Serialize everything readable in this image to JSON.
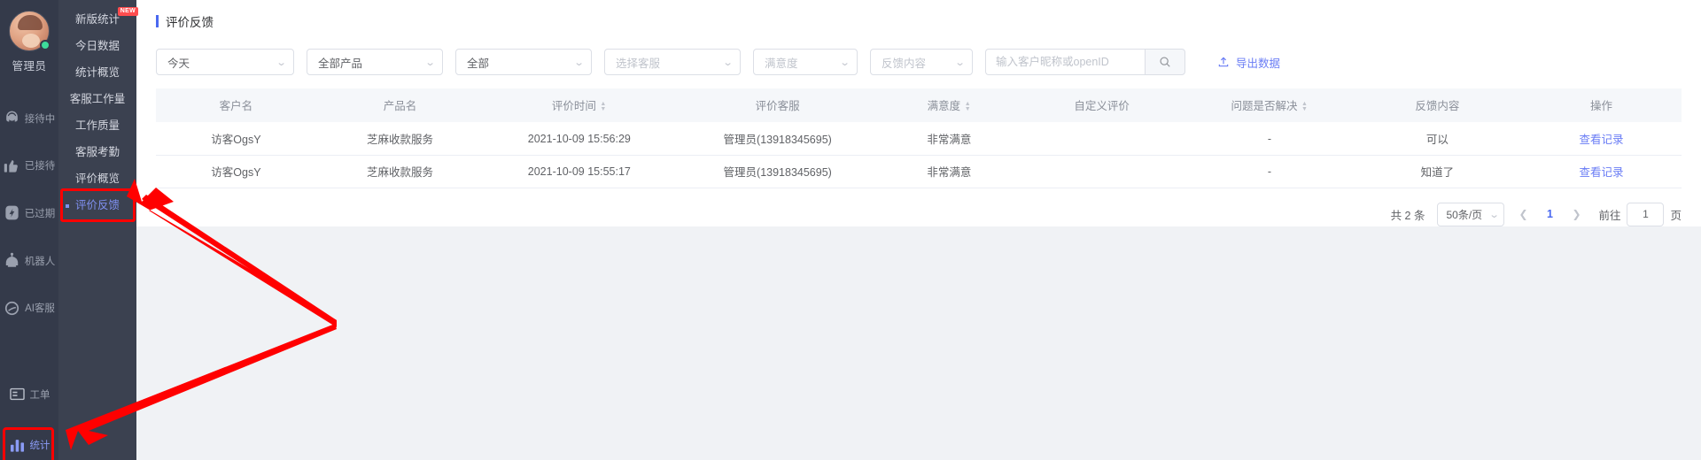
{
  "rail": {
    "user_name": "管理员",
    "items": [
      {
        "label": "接待中",
        "icon": "headset-icon"
      },
      {
        "label": "已接待",
        "icon": "thumbs-up-icon"
      },
      {
        "label": "已过期",
        "icon": "lightning-badge-icon"
      },
      {
        "label": "机器人",
        "icon": "robot-icon"
      },
      {
        "label": "AI客服",
        "icon": "ai-ring-icon"
      },
      {
        "label": "工单",
        "icon": "ticket-icon"
      },
      {
        "label": "统计",
        "icon": "bar-chart-icon"
      }
    ]
  },
  "submenu": {
    "header": "新版统计",
    "badge": "NEW",
    "items": [
      {
        "label": "今日数据"
      },
      {
        "label": "统计概览"
      },
      {
        "label": "客服工作量"
      },
      {
        "label": "工作质量"
      },
      {
        "label": "客服考勤"
      },
      {
        "label": "评价概览"
      },
      {
        "label": "评价反馈"
      }
    ],
    "selected": "评价反馈"
  },
  "page": {
    "title": "评价反馈",
    "accent": "#4a69f0"
  },
  "filters": {
    "date_range": "今天",
    "product": "全部产品",
    "scope": "全部",
    "agent_placeholder": "选择客服",
    "satisfaction_placeholder": "满意度",
    "feedback_placeholder": "反馈内容",
    "search_placeholder": "输入客户昵称或openID",
    "search_value": "",
    "search_icon": "search-icon",
    "export_label": "导出数据",
    "export_icon": "upload-icon"
  },
  "table": {
    "columns": [
      {
        "label": "客户名",
        "sortable": false
      },
      {
        "label": "产品名",
        "sortable": false
      },
      {
        "label": "评价时间",
        "sortable": true
      },
      {
        "label": "评价客服",
        "sortable": false
      },
      {
        "label": "满意度",
        "sortable": true
      },
      {
        "label": "自定义评价",
        "sortable": false
      },
      {
        "label": "问题是否解决",
        "sortable": true
      },
      {
        "label": "反馈内容",
        "sortable": false
      },
      {
        "label": "操作",
        "sortable": false
      }
    ],
    "rows": [
      {
        "customer": "访客OgsY",
        "product": "芝麻收款服务",
        "time": "2021-10-09 15:56:29",
        "agent": "管理员(13918345695)",
        "satisfaction": "非常满意",
        "custom_rating": "",
        "resolved": "-",
        "feedback": "可以",
        "action": "查看记录"
      },
      {
        "customer": "访客OgsY",
        "product": "芝麻收款服务",
        "time": "2021-10-09 15:55:17",
        "agent": "管理员(13918345695)",
        "satisfaction": "非常满意",
        "custom_rating": "",
        "resolved": "-",
        "feedback": "知道了",
        "action": "查看记录"
      }
    ]
  },
  "pagination": {
    "total_label": "共 2 条",
    "page_size": "50条/页",
    "prev_icon": "chevron-left-icon",
    "next_icon": "chevron-right-icon",
    "current_page": "1",
    "jump_prefix": "前往",
    "jump_value": "1",
    "jump_suffix": "页"
  }
}
